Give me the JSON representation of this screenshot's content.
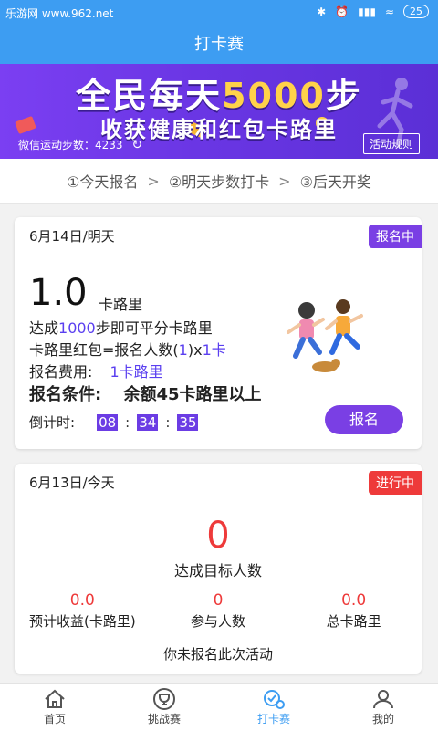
{
  "status_bar": {
    "watermark": "乐游网 www.962.net",
    "battery": "25"
  },
  "app_bar": {
    "title": "打卡赛"
  },
  "banner": {
    "headline_pre": "全民每天",
    "headline_highlight": "5000",
    "headline_post": "步",
    "subline": "收获健康和红包卡路里",
    "wechat_steps": "微信运动步数：4233",
    "rules_button": "活动规则"
  },
  "process": {
    "step1": "①今天报名",
    "step2": "②明天步数打卡",
    "step3": "③后天开奖",
    "arrow": ">"
  },
  "card_upcoming": {
    "date": "6月14日/明天",
    "badge": "报名中",
    "amount": "1.0",
    "unit": "卡路里",
    "rule_pre": "达成",
    "rule_steps": "1000",
    "rule_post": "步即可平分卡路里",
    "redpacket_pre": "卡路里红包=报名人数(",
    "redpacket_count": "1",
    "redpacket_mid": ")x",
    "redpacket_fee": "1卡",
    "fee_label": "报名费用:",
    "fee_value": "1卡路里",
    "condition_label": "报名条件:",
    "condition_value": "余额45卡路里以上",
    "countdown_label": "倒计时:",
    "countdown": {
      "h": "08",
      "m": "34",
      "s": "35",
      "sep": ":"
    },
    "signup_button": "报名"
  },
  "card_ongoing": {
    "date": "6月13日/今天",
    "badge": "进行中",
    "achievers": "0",
    "achievers_label": "达成目标人数",
    "stats": [
      {
        "value": "0.0",
        "label": "预计收益(卡路里)"
      },
      {
        "value": "0",
        "label": "参与人数"
      },
      {
        "value": "0.0",
        "label": "总卡路里"
      }
    ],
    "note": "你未报名此次活动"
  },
  "tabbar": {
    "tabs": [
      {
        "label": "首页",
        "icon": "home-icon"
      },
      {
        "label": "挑战赛",
        "icon": "trophy-icon"
      },
      {
        "label": "打卡赛",
        "icon": "checkin-icon"
      },
      {
        "label": "我的",
        "icon": "user-icon"
      }
    ],
    "active_index": 2
  },
  "colors": {
    "primary": "#3d9df2",
    "accent_purple": "#7a3fe4",
    "accent_red": "#ee3a3a",
    "highlight_yellow": "#ffd24a"
  }
}
